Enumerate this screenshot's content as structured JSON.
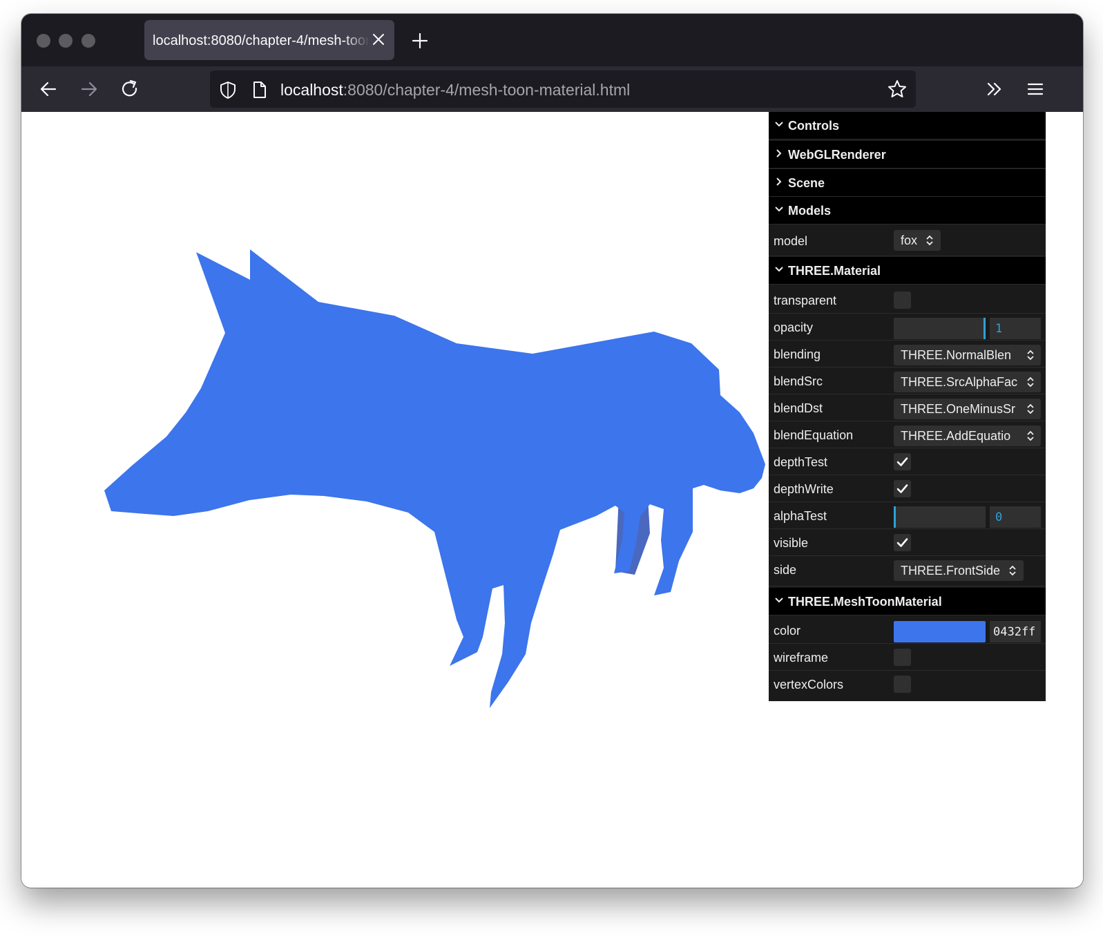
{
  "browser": {
    "tab": {
      "title": "localhost:8080/chapter-4/mesh-toon-material.html"
    },
    "url": {
      "host": "localhost",
      "path": ":8080/chapter-4/mesh-toon-material.html"
    }
  },
  "scene": {
    "model_color": "#3c75ec",
    "shadow_color": "#4a68c0"
  },
  "gui": {
    "folders": {
      "controls": "Controls",
      "renderer": "WebGLRenderer",
      "scene": "Scene",
      "models": "Models",
      "material": "THREE.Material",
      "toon": "THREE.MeshToonMaterial"
    },
    "models": {
      "model_label": "model",
      "model_value": "fox"
    },
    "material": {
      "transparent": {
        "label": "transparent",
        "checked": false
      },
      "opacity": {
        "label": "opacity",
        "value": "1",
        "fraction": 1
      },
      "blending": {
        "label": "blending",
        "value": "THREE.NormalBlen"
      },
      "blendSrc": {
        "label": "blendSrc",
        "value": "THREE.SrcAlphaFac"
      },
      "blendDst": {
        "label": "blendDst",
        "value": "THREE.OneMinusSr"
      },
      "blendEquation": {
        "label": "blendEquation",
        "value": "THREE.AddEquatio"
      },
      "depthTest": {
        "label": "depthTest",
        "checked": true
      },
      "depthWrite": {
        "label": "depthWrite",
        "checked": true
      },
      "alphaTest": {
        "label": "alphaTest",
        "value": "0",
        "fraction": 0
      },
      "visible": {
        "label": "visible",
        "checked": true
      },
      "side": {
        "label": "side",
        "value": "THREE.FrontSide"
      }
    },
    "toon": {
      "color": {
        "label": "color",
        "value": "0432ff",
        "swatch": "#3c75ec"
      },
      "wireframe": {
        "label": "wireframe",
        "checked": false
      },
      "vertexColors": {
        "label": "vertexColors",
        "checked": false
      }
    }
  }
}
